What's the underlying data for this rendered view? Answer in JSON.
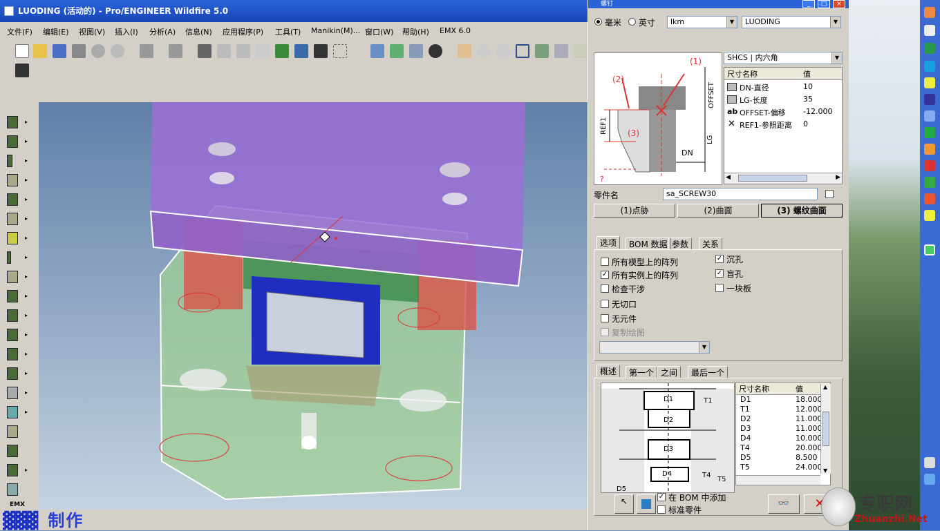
{
  "window": {
    "title": "LUODING (活动的) - Pro/ENGINEER Wildfire 5.0"
  },
  "menu": [
    "文件(F)",
    "编辑(E)",
    "视图(V)",
    "插入(I)",
    "分析(A)",
    "信息(N)",
    "应用程序(P)",
    "工具(T)",
    "Manikin(M)...",
    "窗口(W)",
    "帮助(H)",
    "EMX 6.0"
  ],
  "left_tools_label": "EMX",
  "watermark": "制作",
  "dialog": {
    "title": "螺钉",
    "unit_mm": "毫米",
    "unit_inch": "英寸",
    "supplier": "lkm",
    "assembly": "LUODING",
    "screw_type": "SHCS | 内六角",
    "dims_header": [
      "尺寸名称",
      "值"
    ],
    "dims": [
      {
        "name": "DN-直径",
        "value": "10",
        "icon": "dim-icon"
      },
      {
        "name": "LG-长度",
        "value": "35",
        "icon": "dim-icon"
      },
      {
        "name": "OFFSET-偏移",
        "value": "-12.000",
        "icon": "ab-icon"
      },
      {
        "name": "REF1-参照距离",
        "value": "0",
        "icon": "x-icon"
      }
    ],
    "drawing_labels": {
      "p1": "(1)",
      "p2": "(2)",
      "p3": "(3)",
      "offset": "OFFSET",
      "lg": "LG",
      "ref1": "REF1",
      "dn": "DN",
      "q": "?"
    },
    "part_name_label": "零件名",
    "part_name": "sa_SCREW30",
    "ref_buttons": [
      "(1)点胁",
      "(2)曲面",
      "(3) 螺纹曲面"
    ],
    "tabs": [
      "选项",
      "BOM 数据",
      "参数",
      "关系"
    ],
    "options_left": [
      {
        "label": "所有模型上的阵列",
        "checked": false
      },
      {
        "label": "所有实例上的阵列",
        "checked": true
      },
      {
        "label": "检查干涉",
        "checked": false
      },
      {
        "label": "无切口",
        "checked": false
      },
      {
        "label": "无元件",
        "checked": false
      },
      {
        "label": "复制绘图",
        "checked": false,
        "disabled": true
      }
    ],
    "options_right": [
      {
        "label": "沉孔",
        "checked": true
      },
      {
        "label": "盲孔",
        "checked": true
      },
      {
        "label": "一块板",
        "checked": false
      }
    ],
    "lower_tabs": [
      "概述",
      "第一个",
      "之间",
      "最后一个"
    ],
    "hole_header": [
      "尺寸名称",
      "值"
    ],
    "hole_dims": [
      {
        "name": "D1",
        "value": "18.000"
      },
      {
        "name": "T1",
        "value": "12.000"
      },
      {
        "name": "D2",
        "value": "11.000"
      },
      {
        "name": "D3",
        "value": "11.000"
      },
      {
        "name": "D4",
        "value": "10.000"
      },
      {
        "name": "T4",
        "value": "20.000"
      },
      {
        "name": "D5",
        "value": "8.500"
      },
      {
        "name": "T5",
        "value": "24.000"
      }
    ],
    "hole_labels": {
      "d1": "D1",
      "t1": "T1",
      "d2": "D2",
      "d3": "D3",
      "d4": "D4",
      "t4": "T4",
      "t5": "T5",
      "d5": "D5"
    },
    "bom_add": "在 BOM 中添加",
    "std_part": "标准零件"
  },
  "brand": {
    "cn": "专职网",
    "en": "Zhuanzhi.Net"
  },
  "colors": {
    "purple_plate": "#9b6fd6",
    "red_pillar": "#d9544a",
    "green_plate": "#9fcf96",
    "blue_core": "#1f2ec0",
    "titlebar": "#2a63d8"
  }
}
